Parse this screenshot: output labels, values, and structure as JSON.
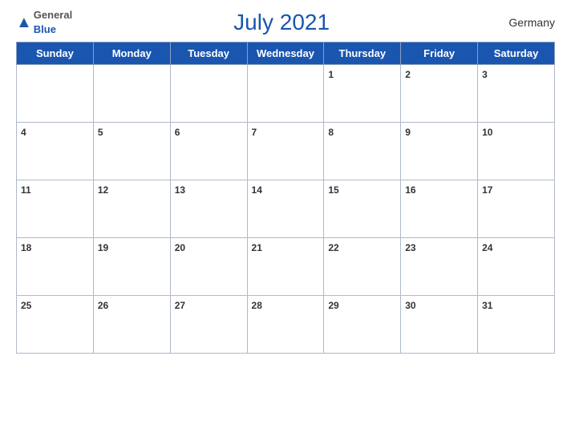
{
  "header": {
    "logo_general": "General",
    "logo_blue": "Blue",
    "title": "July 2021",
    "country": "Germany"
  },
  "days_of_week": [
    "Sunday",
    "Monday",
    "Tuesday",
    "Wednesday",
    "Thursday",
    "Friday",
    "Saturday"
  ],
  "weeks": [
    [
      null,
      null,
      null,
      null,
      1,
      2,
      3
    ],
    [
      4,
      5,
      6,
      7,
      8,
      9,
      10
    ],
    [
      11,
      12,
      13,
      14,
      15,
      16,
      17
    ],
    [
      18,
      19,
      20,
      21,
      22,
      23,
      24
    ],
    [
      25,
      26,
      27,
      28,
      29,
      30,
      31
    ]
  ]
}
